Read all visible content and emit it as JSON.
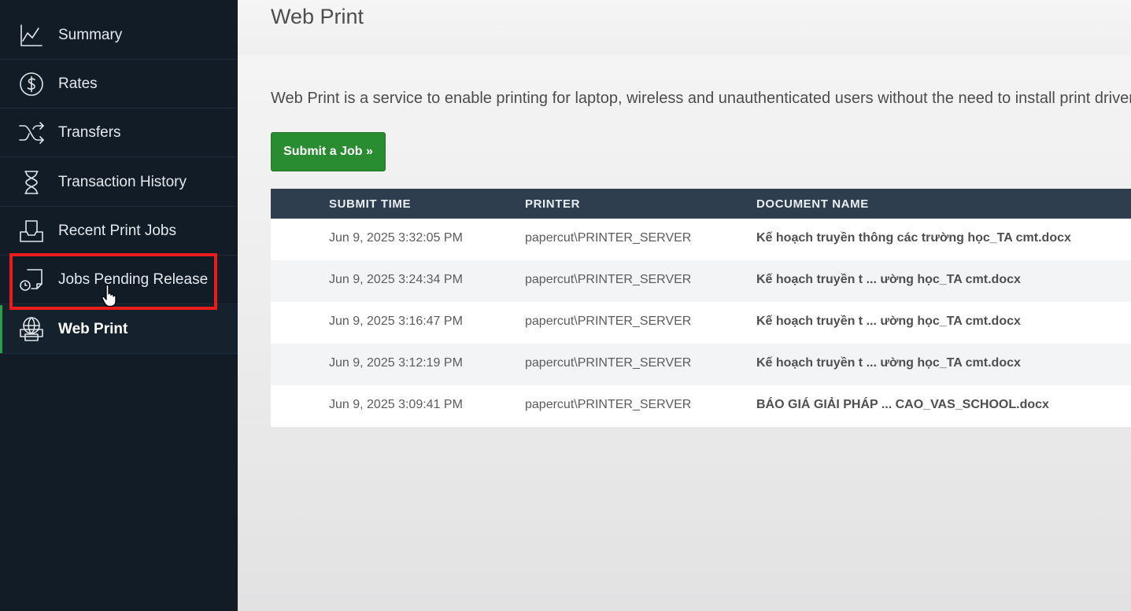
{
  "sidebar": {
    "items": [
      {
        "label": "Summary",
        "icon": "line-chart-icon"
      },
      {
        "label": "Rates",
        "icon": "dollar-circle-icon"
      },
      {
        "label": "Transfers",
        "icon": "shuffle-icon"
      },
      {
        "label": "Transaction History",
        "icon": "hourglass-icon"
      },
      {
        "label": "Recent Print Jobs",
        "icon": "inbox-tray-icon"
      },
      {
        "label": "Jobs Pending Release",
        "icon": "document-clock-icon"
      },
      {
        "label": "Web Print",
        "icon": "globe-printer-icon"
      }
    ],
    "active_item": "Web Print",
    "highlighted_item": "Jobs Pending Release",
    "highlight_color": "#ec1c1c",
    "accent_color": "#2aa043"
  },
  "header": {
    "title": "Web Print"
  },
  "main": {
    "description": "Web Print is a service to enable printing for laptop, wireless and unauthenticated users without the need to install print drivers.",
    "submit_button": "Submit a Job »",
    "submit_button_color": "#2a8c30",
    "table": {
      "columns": [
        "SUBMIT TIME",
        "PRINTER",
        "DOCUMENT NAME"
      ],
      "rows": [
        {
          "submit_time": "Jun 9, 2025 3:32:05 PM",
          "printer": "papercut\\PRINTER_SERVER",
          "document": "Kế hoạch truyền thông các trường học_TA cmt.docx"
        },
        {
          "submit_time": "Jun 9, 2025 3:24:34 PM",
          "printer": "papercut\\PRINTER_SERVER",
          "document": "Kế hoạch truyền t ... ường học_TA cmt.docx"
        },
        {
          "submit_time": "Jun 9, 2025 3:16:47 PM",
          "printer": "papercut\\PRINTER_SERVER",
          "document": "Kế hoạch truyền t ... ường học_TA cmt.docx"
        },
        {
          "submit_time": "Jun 9, 2025 3:12:19 PM",
          "printer": "papercut\\PRINTER_SERVER",
          "document": "Kế hoạch truyền t ... ường học_TA cmt.docx"
        },
        {
          "submit_time": "Jun 9, 2025 3:09:41 PM",
          "printer": "papercut\\PRINTER_SERVER",
          "document": "BÁO GIÁ GIẢI PHÁP ... CAO_VAS_SCHOOL.docx"
        }
      ]
    }
  }
}
